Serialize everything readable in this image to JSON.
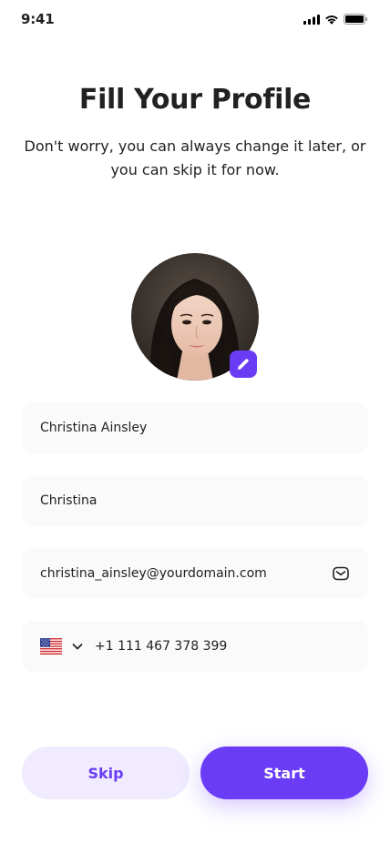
{
  "status_bar": {
    "time": "9:41"
  },
  "header": {
    "title": "Fill Your Profile",
    "subtitle": "Don't worry, you can always change it later, or you can skip it for now."
  },
  "avatar": {
    "edit_icon": "pencil-icon"
  },
  "form": {
    "full_name": "Christina Ainsley",
    "nickname": "Christina",
    "email": "christina_ainsley@yourdomain.com",
    "email_icon": "mail-icon",
    "phone_country": "US",
    "phone": "+1 111 467 378 399"
  },
  "actions": {
    "skip_label": "Skip",
    "start_label": "Start"
  },
  "colors": {
    "primary": "#6a3cf6",
    "primary_light": "#f0ebff",
    "field_bg": "#fafafa",
    "text": "#212121"
  }
}
